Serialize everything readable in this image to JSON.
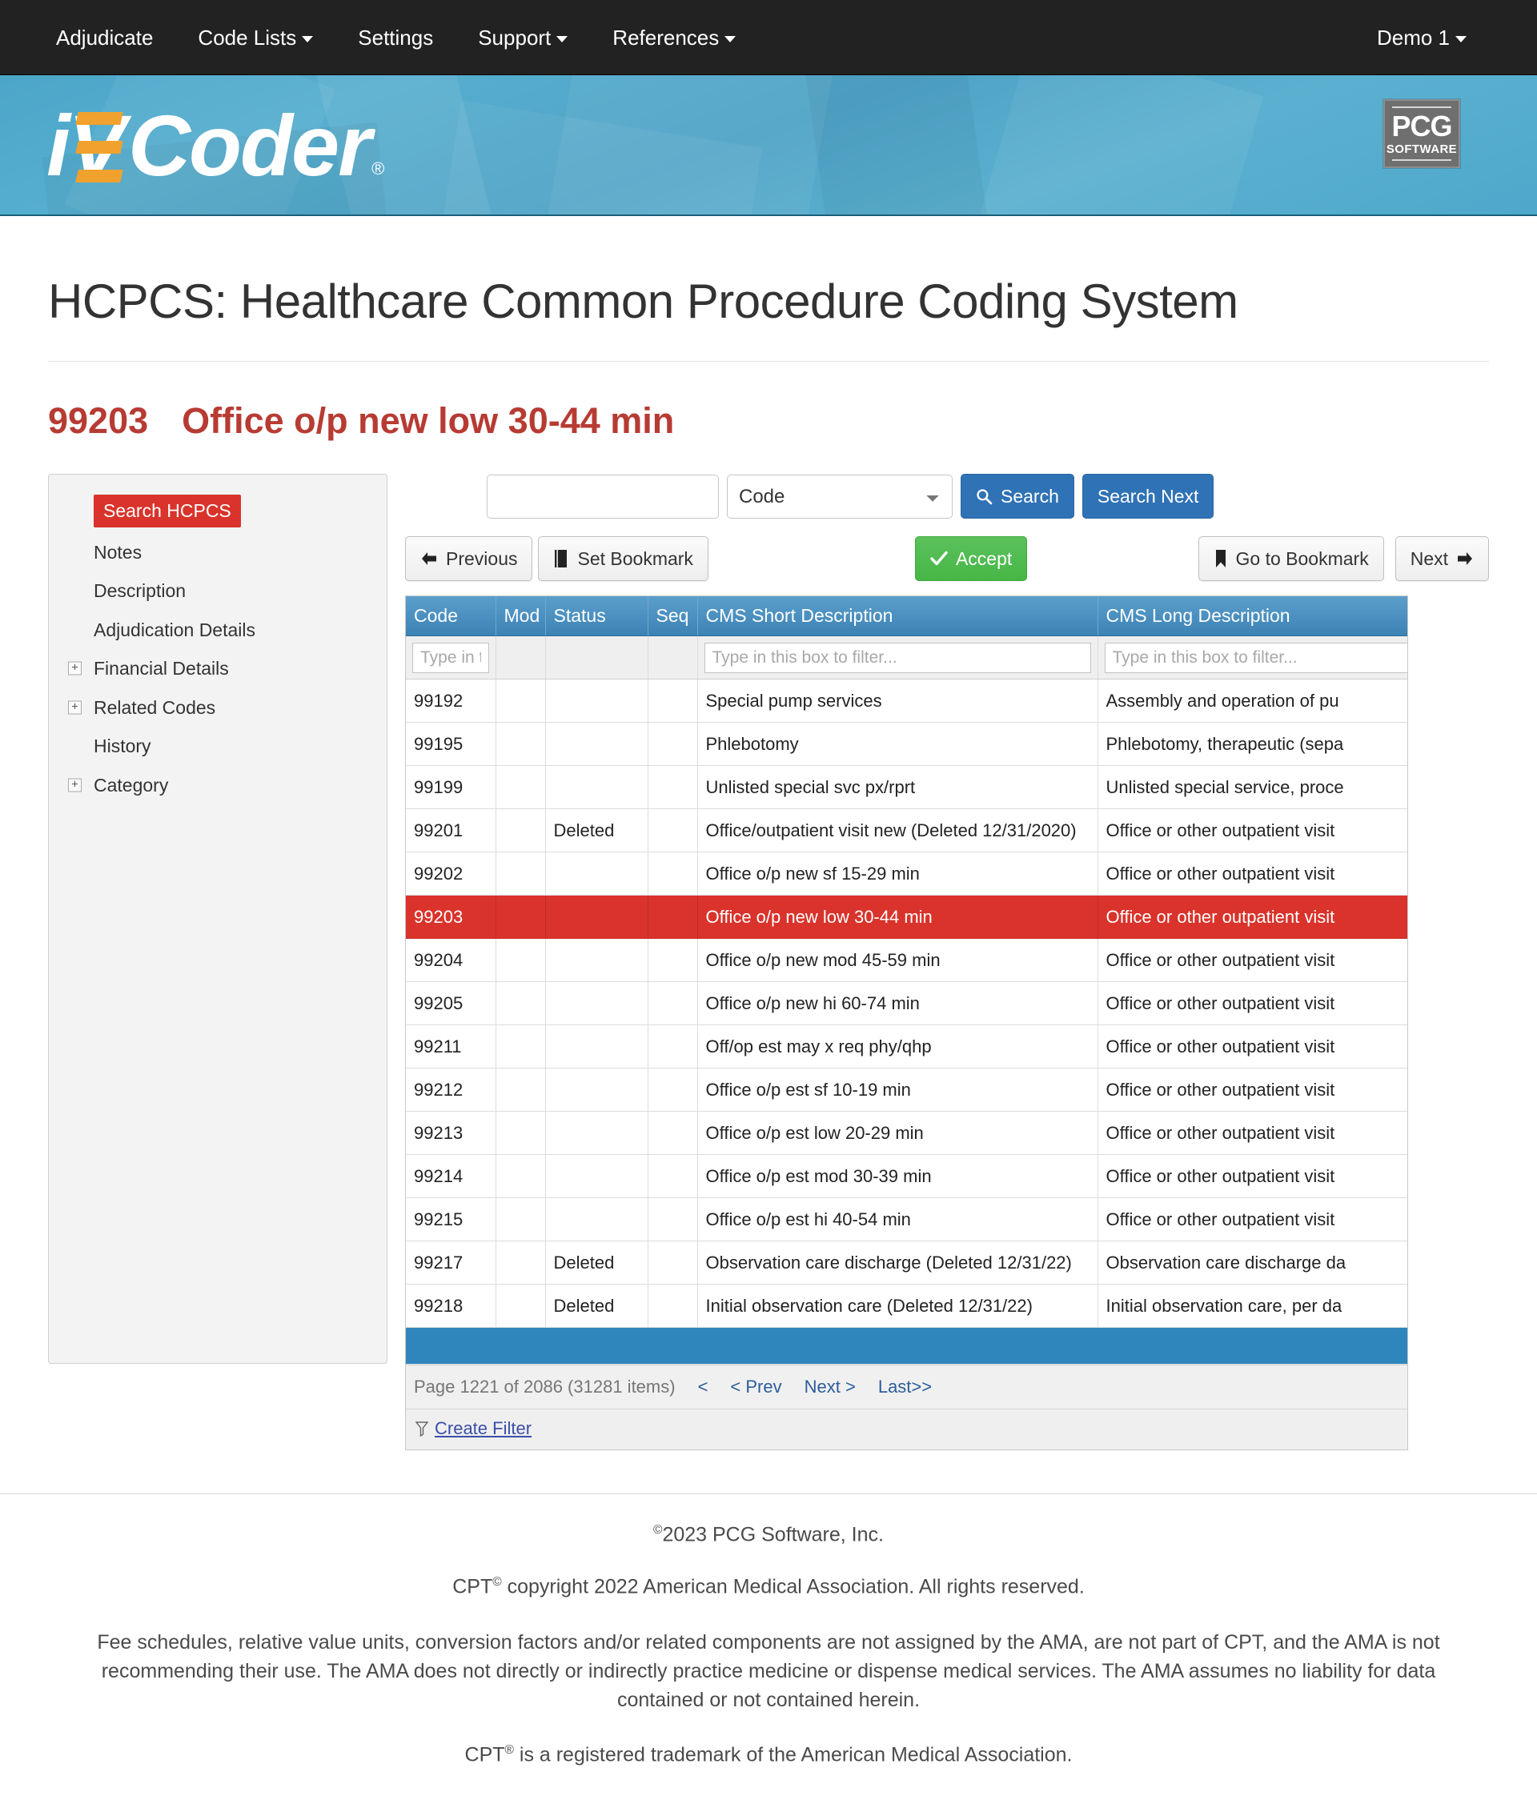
{
  "navbar": {
    "items": [
      {
        "label": "Adjudicate",
        "caret": false
      },
      {
        "label": "Code Lists",
        "caret": true
      },
      {
        "label": "Settings",
        "caret": false
      },
      {
        "label": "Support",
        "caret": true
      },
      {
        "label": "References",
        "caret": true
      }
    ],
    "user": {
      "label": "Demo 1",
      "caret": true
    }
  },
  "banner": {
    "logo_i": "i",
    "logo_v": "V",
    "logo_coder": "Coder",
    "logo_registered": "®",
    "pcg_main": "PCG",
    "pcg_sub": "SOFTWARE"
  },
  "page": {
    "title": "HCPCS: Healthcare Common Procedure Coding System",
    "code": "99203",
    "code_description": "Office o/p new low 30-44 min"
  },
  "sidebar": {
    "items": [
      {
        "label": "Search HCPCS",
        "active": true,
        "expandable": false
      },
      {
        "label": "Notes",
        "active": false,
        "expandable": false
      },
      {
        "label": "Description",
        "active": false,
        "expandable": false
      },
      {
        "label": "Adjudication Details",
        "active": false,
        "expandable": false
      },
      {
        "label": "Financial Details",
        "active": false,
        "expandable": true
      },
      {
        "label": "Related Codes",
        "active": false,
        "expandable": true
      },
      {
        "label": "History",
        "active": false,
        "expandable": false
      },
      {
        "label": "Category",
        "active": false,
        "expandable": true
      }
    ],
    "expand_glyph": "+"
  },
  "search": {
    "input_value": "",
    "input_placeholder": "",
    "field_selected": "Code",
    "field_options": [
      "Code"
    ],
    "search_label": "Search",
    "search_next_label": "Search Next",
    "search_icon": "search-icon"
  },
  "toolbar": {
    "previous_label": "Previous",
    "set_bookmark_label": "Set Bookmark",
    "accept_label": "Accept",
    "go_to_bookmark_label": "Go to Bookmark",
    "next_label": "Next"
  },
  "grid": {
    "columns": [
      {
        "key": "code",
        "label": "Code"
      },
      {
        "key": "mod",
        "label": "Mod"
      },
      {
        "key": "status",
        "label": "Status"
      },
      {
        "key": "seq",
        "label": "Seq"
      },
      {
        "key": "short",
        "label": "CMS Short Description"
      },
      {
        "key": "long",
        "label": "CMS Long Description"
      }
    ],
    "filters": {
      "code_placeholder": "Type in this box to filter...",
      "mod_placeholder": "",
      "status_placeholder": "",
      "seq_placeholder": "",
      "short_placeholder": "Type in this box to filter...",
      "long_placeholder": "Type in this box to filter..."
    },
    "rows": [
      {
        "code": "99192",
        "mod": "",
        "status": "",
        "seq": "",
        "short": "Special pump services",
        "long": "Assembly and operation of pu",
        "selected": false
      },
      {
        "code": "99195",
        "mod": "",
        "status": "",
        "seq": "",
        "short": "Phlebotomy",
        "long": "Phlebotomy, therapeutic (sepa",
        "selected": false
      },
      {
        "code": "99199",
        "mod": "",
        "status": "",
        "seq": "",
        "short": "Unlisted special svc px/rprt",
        "long": "Unlisted special service, proce",
        "selected": false
      },
      {
        "code": "99201",
        "mod": "",
        "status": "Deleted",
        "seq": "",
        "short": "Office/outpatient visit new (Deleted 12/31/2020)",
        "long": "Office or other outpatient visit",
        "selected": false
      },
      {
        "code": "99202",
        "mod": "",
        "status": "",
        "seq": "",
        "short": "Office o/p new sf 15-29 min",
        "long": "Office or other outpatient visit",
        "selected": false
      },
      {
        "code": "99203",
        "mod": "",
        "status": "",
        "seq": "",
        "short": "Office o/p new low 30-44 min",
        "long": "Office or other outpatient visit",
        "selected": true
      },
      {
        "code": "99204",
        "mod": "",
        "status": "",
        "seq": "",
        "short": "Office o/p new mod 45-59 min",
        "long": "Office or other outpatient visit",
        "selected": false
      },
      {
        "code": "99205",
        "mod": "",
        "status": "",
        "seq": "",
        "short": "Office o/p new hi 60-74 min",
        "long": "Office or other outpatient visit",
        "selected": false
      },
      {
        "code": "99211",
        "mod": "",
        "status": "",
        "seq": "",
        "short": "Off/op est may x req phy/qhp",
        "long": "Office or other outpatient visit",
        "selected": false
      },
      {
        "code": "99212",
        "mod": "",
        "status": "",
        "seq": "",
        "short": "Office o/p est sf 10-19 min",
        "long": "Office or other outpatient visit",
        "selected": false
      },
      {
        "code": "99213",
        "mod": "",
        "status": "",
        "seq": "",
        "short": "Office o/p est low 20-29 min",
        "long": "Office or other outpatient visit",
        "selected": false
      },
      {
        "code": "99214",
        "mod": "",
        "status": "",
        "seq": "",
        "short": "Office o/p est mod 30-39 min",
        "long": "Office or other outpatient visit",
        "selected": false
      },
      {
        "code": "99215",
        "mod": "",
        "status": "",
        "seq": "",
        "short": "Office o/p est hi 40-54 min",
        "long": "Office or other outpatient visit",
        "selected": false
      },
      {
        "code": "99217",
        "mod": "",
        "status": "Deleted",
        "seq": "",
        "short": "Observation care discharge (Deleted 12/31/22)",
        "long": "Observation care discharge da",
        "selected": false
      },
      {
        "code": "99218",
        "mod": "",
        "status": "Deleted",
        "seq": "",
        "short": "Initial observation care (Deleted 12/31/22)",
        "long": "Initial observation care, per da",
        "selected": false
      }
    ],
    "pager": {
      "summary": "Page 1221 of 2086 (31281 items)",
      "first": "<",
      "prev": "< Prev",
      "next": "Next >",
      "last": "Last>>"
    },
    "create_filter_label": "Create Filter"
  },
  "footer": {
    "copyright": "2023 PCG Software, Inc.",
    "copyright_sup": "©",
    "cpt_prefix": "CPT",
    "cpt_sup": "©",
    "cpt_rest": " copyright 2022 American Medical Association. All rights reserved.",
    "disclaimer": "Fee schedules, relative value units, conversion factors and/or related components are not assigned by the AMA, are not part of CPT, and the AMA is not recommending their use. The AMA does not directly or indirectly practice medicine or dispense medical services. The AMA assumes no liability for data contained or not contained herein.",
    "trademark_prefix": "CPT",
    "trademark_sup": "®",
    "trademark_rest": " is a registered trademark of the American Medical Association."
  },
  "colors": {
    "navbar_bg": "#222222",
    "banner_blue": "#4ea8cb",
    "accent_red": "#d9332b",
    "title_red": "#b73b33",
    "primary_blue": "#2f72b5",
    "success_green": "#46b646",
    "grid_header_blue": "#3c82b4"
  }
}
